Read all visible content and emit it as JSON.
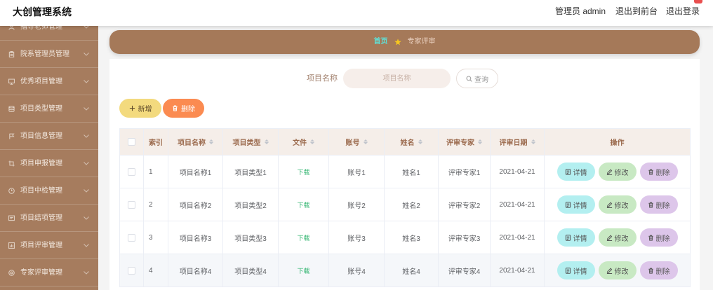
{
  "header": {
    "title": "大创管理系统",
    "user_label": "管理员 admin",
    "front_link": "退出到前台",
    "logout_link": "退出登录"
  },
  "sidebar": {
    "items": [
      {
        "label": "指导老师管理",
        "icon": "teacher-icon"
      },
      {
        "label": "院系管理员管理",
        "icon": "clipboard-icon"
      },
      {
        "label": "优秀项目管理",
        "icon": "monitor-icon"
      },
      {
        "label": "项目类型管理",
        "icon": "database-icon"
      },
      {
        "label": "项目信息管理",
        "icon": "flag-icon"
      },
      {
        "label": "项目申报管理",
        "icon": "crop-icon"
      },
      {
        "label": "项目中检管理",
        "icon": "clock-icon"
      },
      {
        "label": "项目结项管理",
        "icon": "message-icon"
      },
      {
        "label": "项目评审管理",
        "icon": "chart-icon"
      },
      {
        "label": "专家评审管理",
        "icon": "help-icon"
      }
    ]
  },
  "breadcrumb": {
    "home": "首页",
    "separator_icon": "star-icon",
    "current": "专家评审"
  },
  "search": {
    "label": "项目名称",
    "placeholder": "项目名称",
    "value": "",
    "button_label": "查询",
    "button_icon": "search-icon"
  },
  "toolbar": {
    "add_label": "新增",
    "add_icon": "plus-icon",
    "delete_label": "删除",
    "delete_icon": "trash-icon"
  },
  "table": {
    "select_all": false,
    "columns": [
      {
        "label": "索引",
        "sortable": false
      },
      {
        "label": "项目名称",
        "sortable": true
      },
      {
        "label": "项目类型",
        "sortable": true
      },
      {
        "label": "文件",
        "sortable": true
      },
      {
        "label": "账号",
        "sortable": true
      },
      {
        "label": "姓名",
        "sortable": true
      },
      {
        "label": "评审专家",
        "sortable": true
      },
      {
        "label": "评审日期",
        "sortable": true
      },
      {
        "label": "操作",
        "sortable": false
      }
    ],
    "rows": [
      {
        "selected": false,
        "index": "1",
        "project_name": "项目名称1",
        "project_type": "项目类型1",
        "file": "下载",
        "account": "账号1",
        "name": "姓名1",
        "reviewer": "评审专家1",
        "review_date": "2021-04-21"
      },
      {
        "selected": false,
        "index": "2",
        "project_name": "项目名称2",
        "project_type": "项目类型2",
        "file": "下载",
        "account": "账号2",
        "name": "姓名2",
        "reviewer": "评审专家2",
        "review_date": "2021-04-21"
      },
      {
        "selected": false,
        "index": "3",
        "project_name": "项目名称3",
        "project_type": "项目类型3",
        "file": "下载",
        "account": "账号3",
        "name": "姓名3",
        "reviewer": "评审专家3",
        "review_date": "2021-04-21"
      },
      {
        "selected": false,
        "index": "4",
        "project_name": "项目名称4",
        "project_type": "项目类型4",
        "file": "下载",
        "account": "账号4",
        "name": "姓名4",
        "reviewer": "评审专家4",
        "review_date": "2021-04-21"
      }
    ],
    "row_actions": {
      "detail": "详情",
      "detail_icon": "document-icon",
      "edit": "修改",
      "edit_icon": "edit-icon",
      "delete": "删除",
      "delete_icon": "trash-icon"
    }
  },
  "theme": {
    "sidebar_bg": "#a67c5e",
    "crumb_bg": "#a57959",
    "crumb_home": "#5fe0d6",
    "crumb_star": "#f7c71f",
    "th_bg": "#f5eee9",
    "th_text": "#9b6a4d",
    "add_bg": "#f3da7e",
    "del_bg": "#fb8b51",
    "detail_bg": "#b3eff0",
    "edit_bg": "#c8e9c3",
    "row_del_bg": "#ddc6ea",
    "download": "#2fb46e",
    "badge": "#e94f4f"
  }
}
